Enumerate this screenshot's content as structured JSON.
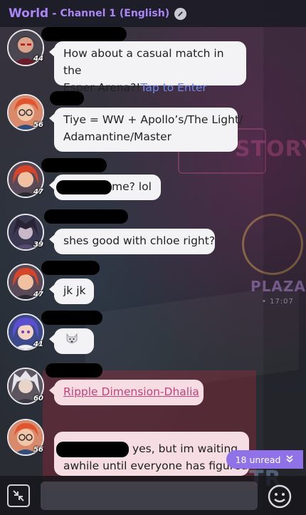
{
  "header": {
    "world": "World",
    "separator": "-",
    "channel": "Channel 1 (English)"
  },
  "messages": [
    {
      "level": "44",
      "text": "How about a casual match in the",
      "text2": "Esper Arena?!",
      "link": "Tap to Enter"
    },
    {
      "level": "56",
      "text": "Tiye = WW + Apollo’s/The Light/",
      "text2": "Adamantine/Master"
    },
    {
      "level": "47",
      "text": "me? lol"
    },
    {
      "level": "39",
      "text": "shes good with chloe right?"
    },
    {
      "level": "47",
      "text": "jk jk"
    },
    {
      "level": "41",
      "text": ""
    },
    {
      "level": "60",
      "link": "Ripple Dimension-Dhalia"
    },
    {
      "level": "56",
      "text": "yes, but im waiting",
      "text2": "awhile until everyone has figured"
    }
  ],
  "background_text": {
    "story": "STORY",
    "plaza": "PLAZA",
    "time": "• 17:07",
    "tr": "TR"
  },
  "unread": {
    "count_label": "18 unread"
  },
  "input": {
    "placeholder": ""
  },
  "colors": {
    "accent": "#a985f5",
    "unread_bg": "#8f72e8",
    "link": "#6f88f0",
    "pink_link": "#c9407a"
  },
  "icons": [
    "edit-icon",
    "collapse-icon",
    "chevron-double-down-icon",
    "emoji-icon",
    "wolf-emoji-icon"
  ]
}
